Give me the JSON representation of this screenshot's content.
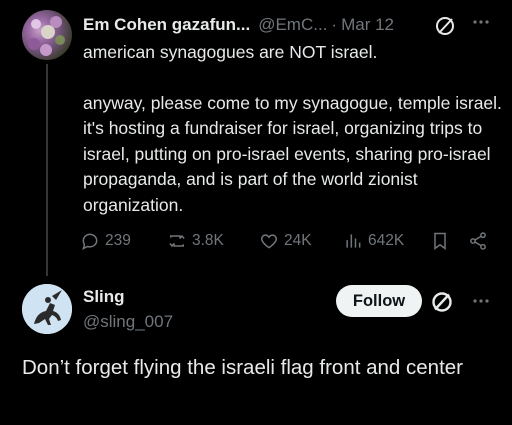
{
  "post": {
    "display_name": "Em Cohen gazafun...",
    "handle": "@EmC...",
    "separator": "·",
    "date": "Mar 12",
    "paragraph1": "american synagogues are NOT israel.",
    "paragraph2": "anyway, please come to my synagogue, temple israel. it's hosting a fundraiser for israel, organizing trips to israel, putting on pro-israel events, sharing pro-israel propaganda, and is part of the world zionist organization.",
    "replies": "239",
    "reposts": "3.8K",
    "likes": "24K",
    "views": "642K",
    "icons": [
      "reply-icon",
      "repost-icon",
      "like-icon",
      "views-icon",
      "bookmark-icon",
      "share-icon",
      "verified-icon",
      "more-icon"
    ]
  },
  "reply": {
    "display_name": "Sling",
    "handle": "@sling_007",
    "follow_label": "Follow",
    "text": "Don’t forget flying the israeli flag front and center"
  },
  "colors": {
    "background": "#000000",
    "text": "#e7e9ea",
    "muted": "#71767b",
    "follow_bg": "#eff3f4"
  }
}
